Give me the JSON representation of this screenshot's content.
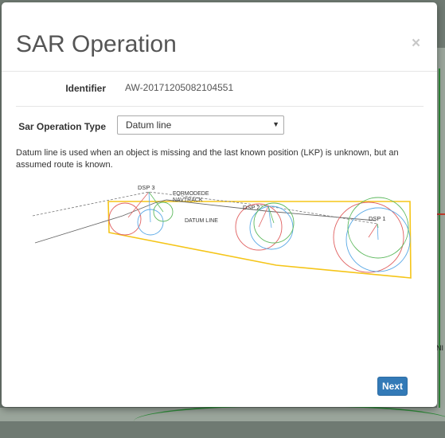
{
  "modal": {
    "title": "SAR Operation",
    "close_glyph": "×",
    "identifier": {
      "label": "Identifier",
      "value": "AW-20171205082104551"
    },
    "operation_type": {
      "label": "Sar Operation Type",
      "selected": "Datum line",
      "caret": "▼"
    },
    "description": "Datum line is used when an object is missing and the last known position (LKP) is unknown, but an assumed route is known.",
    "diagram": {
      "labels": {
        "dsp3": "DSP 3",
        "dsp2": "DSP 2",
        "dsp1": "DSP 1",
        "formodede": "FORMODEDE",
        "navtrack": "NAVTRACK",
        "datum_line": "DATUM LINE"
      },
      "colors": {
        "area": "#f5c518",
        "red": "#e06060",
        "blue": "#5aa9e6",
        "green": "#5cb85c",
        "line": "#666666"
      }
    },
    "next_label": "Next"
  },
  "backdrop": {
    "map_text": "NI"
  },
  "colors": {
    "primary": "#337ab7"
  }
}
